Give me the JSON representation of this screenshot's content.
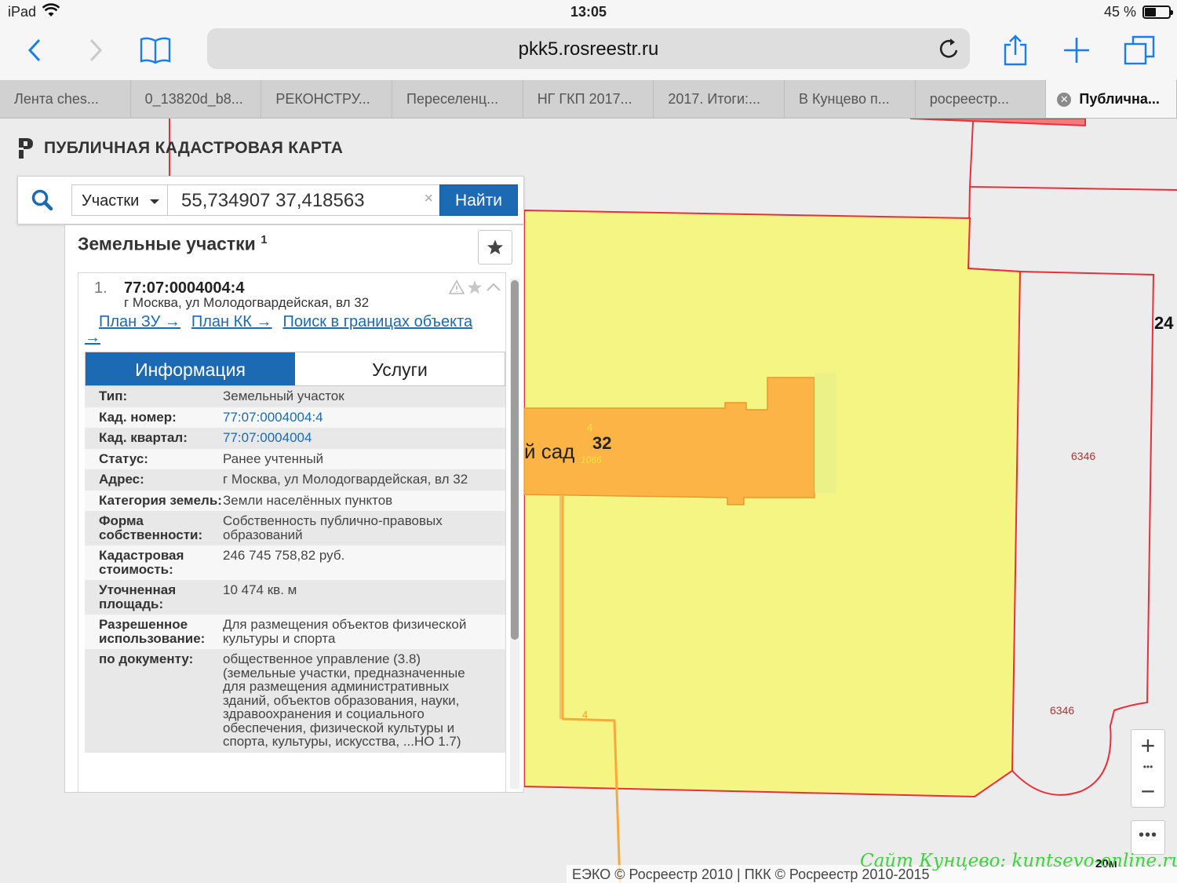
{
  "status_bar": {
    "device": "iPad",
    "time": "13:05",
    "battery": "45 %",
    "battery_level": 0.45
  },
  "browser": {
    "url": "pkk5.rosreestr.ru",
    "tabs": [
      {
        "label": "Лента ches..."
      },
      {
        "label": "0_13820d_b8..."
      },
      {
        "label": "РЕКОНСТРУ..."
      },
      {
        "label": "Переселенц..."
      },
      {
        "label": "НГ ГКП 2017..."
      },
      {
        "label": "2017. Итоги:..."
      },
      {
        "label": "В Кунцево п..."
      },
      {
        "label": "росреестр..."
      },
      {
        "label": "Публична..."
      }
    ]
  },
  "site": {
    "title": "ПУБЛИЧНАЯ КАДАСТРОВАЯ КАРТА"
  },
  "search": {
    "type_selected": "Участки",
    "query": "55,734907 37,418563",
    "clear": "×",
    "button": "Найти"
  },
  "results": {
    "header": "Земельные участки",
    "count": "1",
    "item": {
      "index": "1.",
      "cad_number": "77:07:0004004:4",
      "address": "г Москва, ул Молодогвардейская, вл 32",
      "links": [
        "План ЗУ →",
        "План КК →",
        "Поиск в границах объекта →"
      ],
      "tabs": [
        "Информация",
        "Услуги"
      ],
      "fields": [
        {
          "key": "Тип:",
          "value": "Земельный участок"
        },
        {
          "key": "Кад. номер:",
          "value": "77:07:0004004:4"
        },
        {
          "key": "Кад. квартал:",
          "value": "77:07:0004004"
        },
        {
          "key": "Статус:",
          "value": "Ранее учтенный"
        },
        {
          "key": "Адрес:",
          "value": "г Москва, ул Молодогвардейская, вл 32"
        },
        {
          "key": "Категория земель:",
          "value": "Земли населённых пунктов"
        },
        {
          "key": "Форма собственности:",
          "value": "Собственность публично-правовых образований"
        },
        {
          "key": "Кадастровая стоимость:",
          "value": "246 745 758,82 руб."
        },
        {
          "key": "Уточненная площадь:",
          "value": "10 474 кв. м"
        },
        {
          "key": "Разрешенное использование:",
          "value": "Для размещения объектов физической культуры и спорта"
        },
        {
          "key": "по документу:",
          "value": "общественное управление (3.8) (земельные участки, предназначенные для размещения административных зданий, объектов образования, науки, здравоохранения и социального обеспечения, физической культуры и спорта, культуры, искусства,  ...НО 1.7)"
        }
      ]
    }
  },
  "map": {
    "labels": {
      "building_name": "й сад",
      "building_number": "32",
      "small_num_4": "4",
      "small_1066": "1066",
      "parcel_6346_a": "6346",
      "parcel_6346_b": "6346",
      "edge_24": "24",
      "line_4": "4"
    },
    "controls": {
      "zoom_in": "+",
      "zoom_out": "−",
      "dots": "•••",
      "more": "•••"
    },
    "scale": "20м",
    "copyright": "ЕЭКО © Росреестр 2010 | ПКК © Росреестр 2010-2015",
    "watermark": "Сайт Кунцево:  kuntsevo-online.ru",
    "colors": {
      "parcel_fill": "#f5f584",
      "building_fill": "#fbb445",
      "boundary": "#e8303c",
      "accent": "#1b6ab3"
    }
  }
}
